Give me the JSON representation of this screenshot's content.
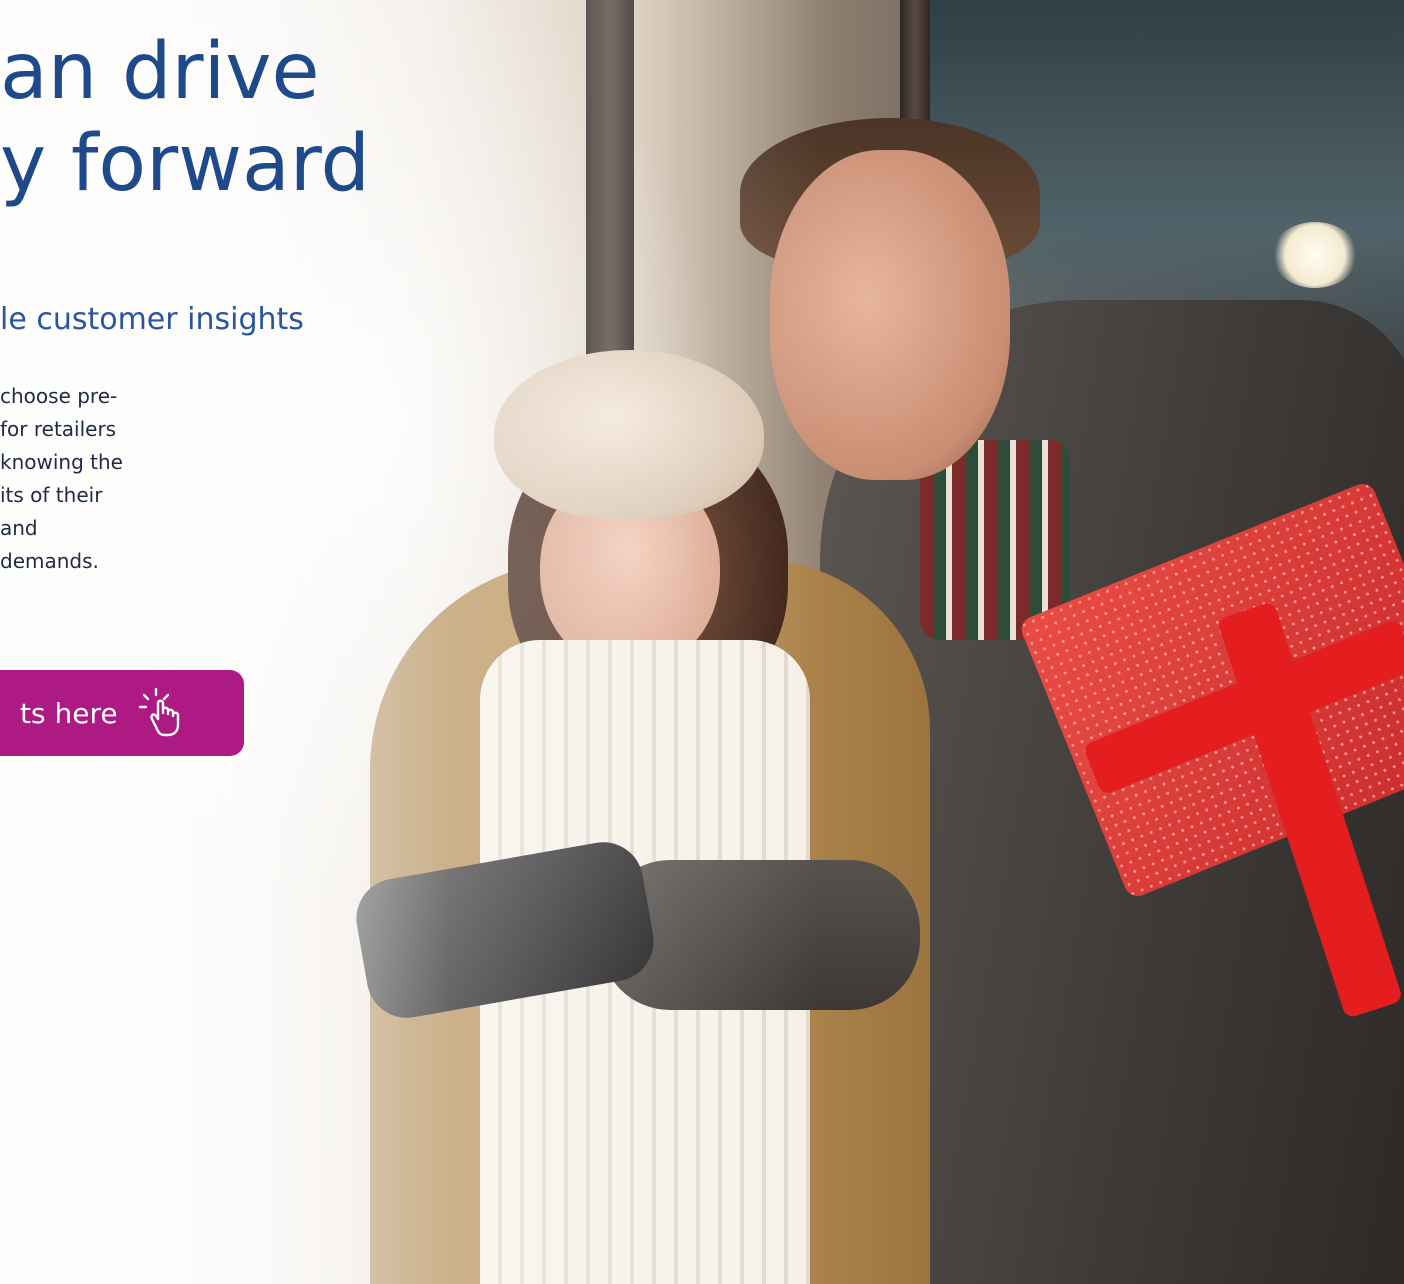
{
  "hero": {
    "headline_lines": [
      "an drive",
      "y forward"
    ],
    "subheading": "le customer insights",
    "body_lines": [
      "choose pre-",
      "for retailers",
      "knowing the",
      "its of their",
      "and",
      "demands."
    ],
    "cta": {
      "label": "ts here",
      "icon": "pointer-hand-click-icon"
    }
  },
  "colors": {
    "headline": "#1e4a8c",
    "subheading": "#2a56a0",
    "body": "#1f2a44",
    "cta_bg": "#ad1a83",
    "cta_text": "#ffffff"
  }
}
